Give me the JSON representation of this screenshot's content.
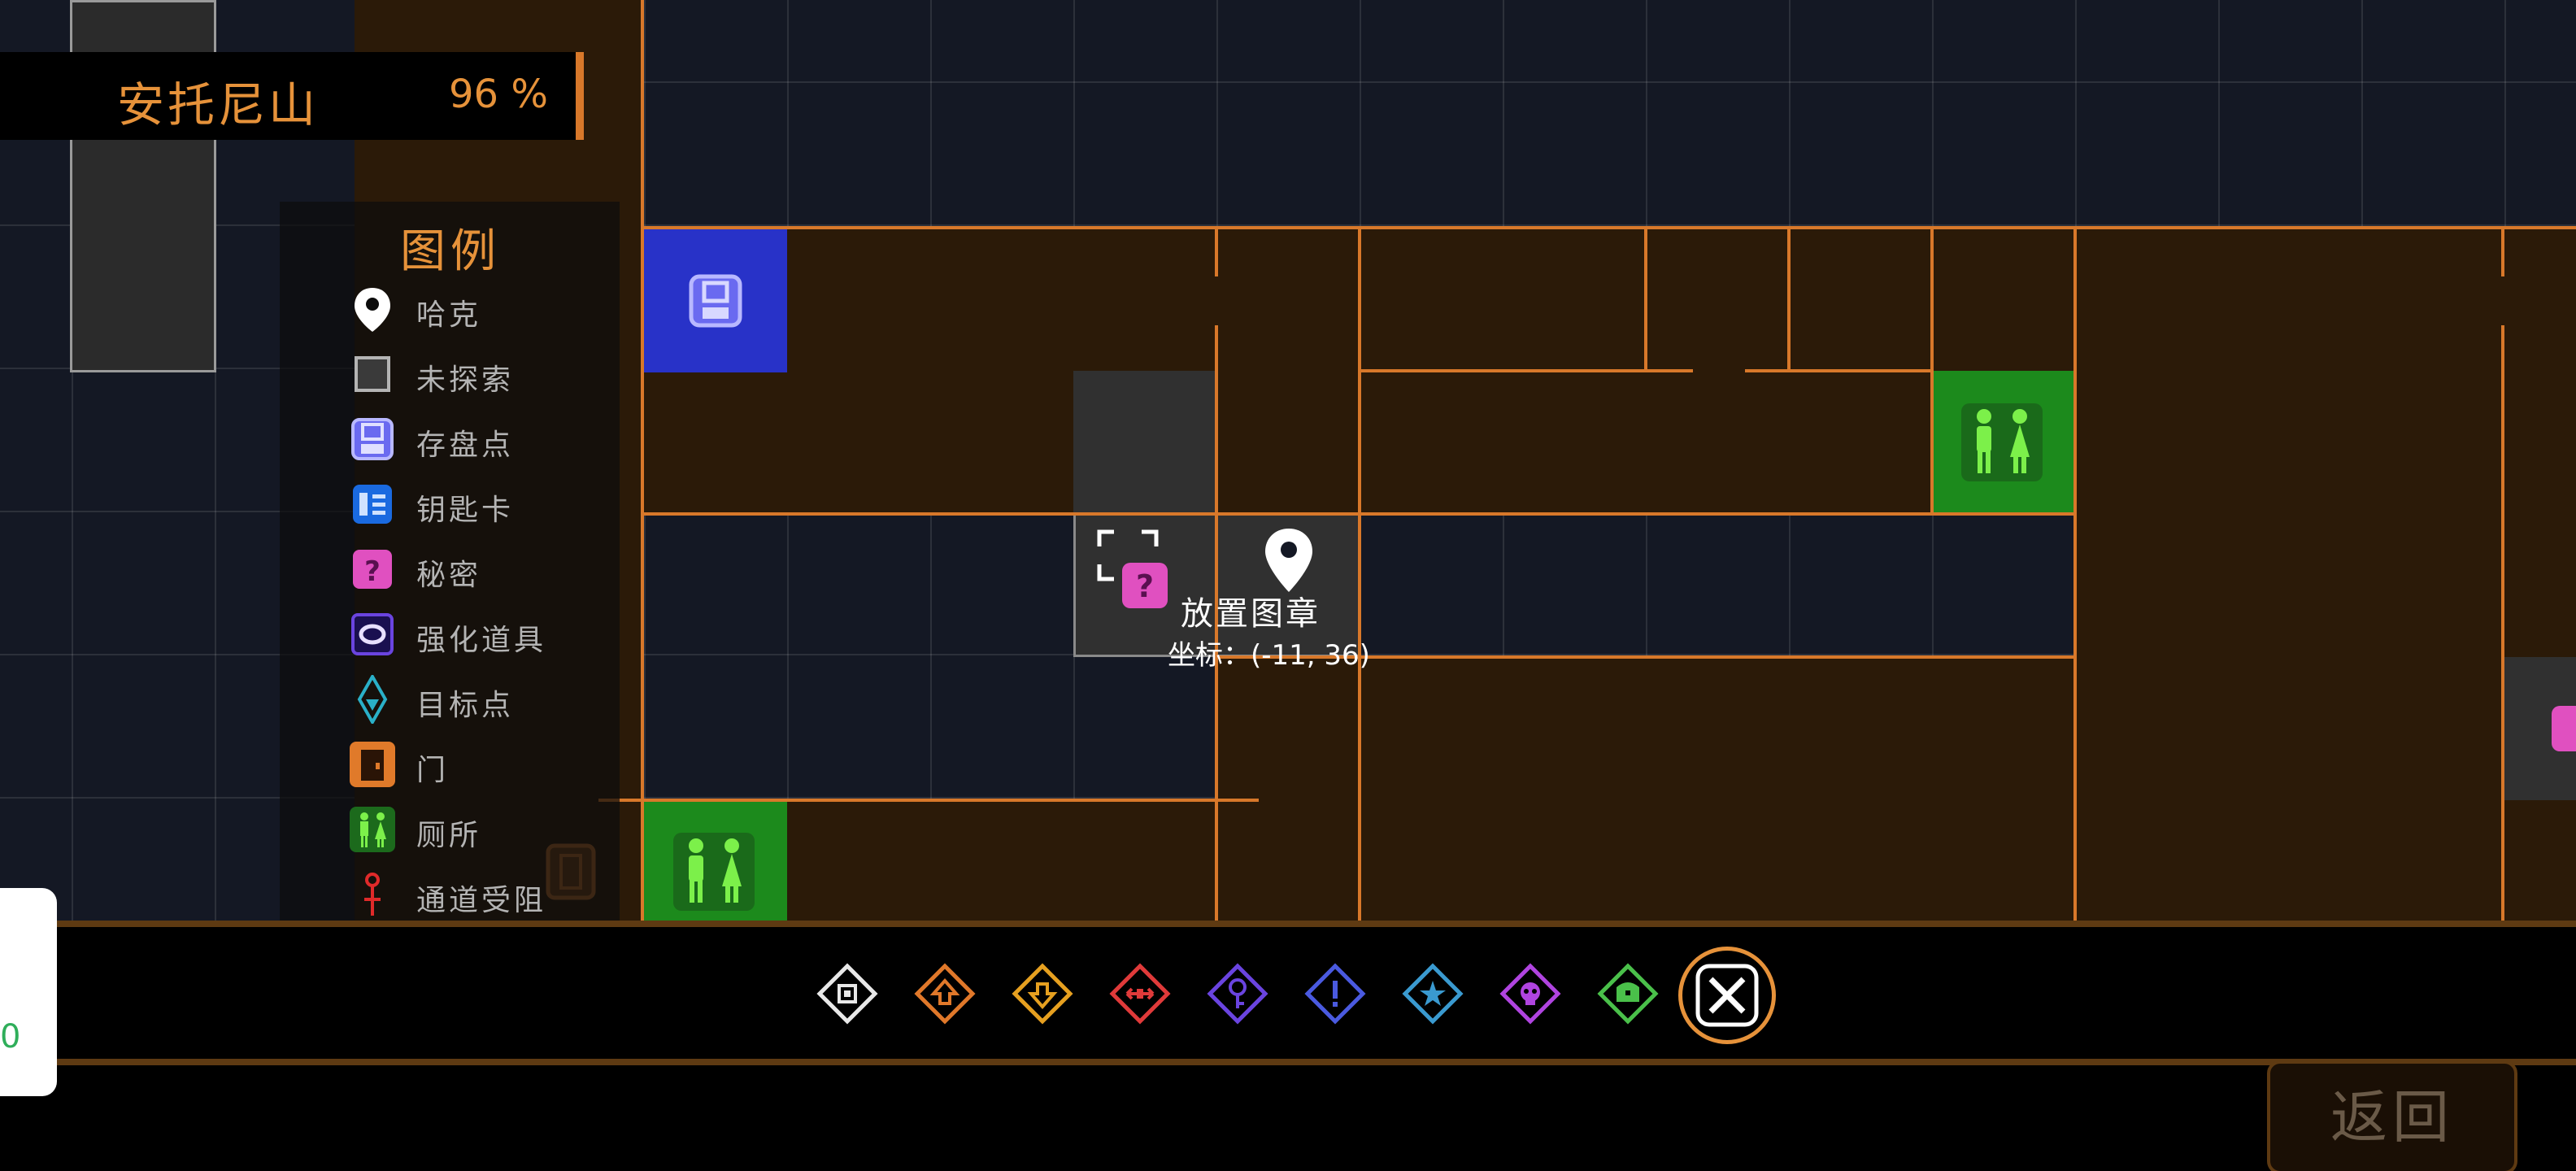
{
  "area": {
    "name": "安托尼山",
    "completion": "96 %"
  },
  "legend": {
    "title": "图例",
    "items": [
      {
        "icon": "location-pin-icon",
        "label": "哈克"
      },
      {
        "icon": "unexplored-square-icon",
        "label": "未探索"
      },
      {
        "icon": "save-point-icon",
        "label": "存盘点"
      },
      {
        "icon": "keycard-icon",
        "label": "钥匙卡"
      },
      {
        "icon": "secret-icon",
        "label": "秘密"
      },
      {
        "icon": "upgrade-item-icon",
        "label": "强化道具"
      },
      {
        "icon": "target-point-icon",
        "label": "目标点"
      },
      {
        "icon": "door-icon",
        "label": "门"
      },
      {
        "icon": "restroom-icon",
        "label": "厕所"
      },
      {
        "icon": "blocked-path-icon",
        "label": "通道受阻"
      }
    ]
  },
  "marker": {
    "label": "放置图章",
    "coords": "坐标：(-11, 36)"
  },
  "stamps": [
    {
      "icon": "stamp-white-icon",
      "color": "#e8e8e8"
    },
    {
      "icon": "stamp-up-icon",
      "color": "#e0782a"
    },
    {
      "icon": "stamp-down-icon",
      "color": "#e6a020"
    },
    {
      "icon": "stamp-swap-icon",
      "color": "#e03a3a"
    },
    {
      "icon": "stamp-key-icon",
      "color": "#6a44e0"
    },
    {
      "icon": "stamp-alert-icon",
      "color": "#4a5ae0"
    },
    {
      "icon": "stamp-star-icon",
      "color": "#3a9ad0"
    },
    {
      "icon": "stamp-skull-icon",
      "color": "#b044e0"
    },
    {
      "icon": "stamp-chest-icon",
      "color": "#4ac04a"
    }
  ],
  "close_button": {
    "icon": "close-x-icon"
  },
  "back_button": {
    "label": "返回"
  },
  "side_card": {
    "text": "0"
  },
  "colors": {
    "accent_orange": "#d8782a",
    "room_brown": "#2b1a08",
    "save_blue": "#2832c8",
    "restroom_green": "#1c8a1c",
    "secret_pink": "#e050c0"
  }
}
